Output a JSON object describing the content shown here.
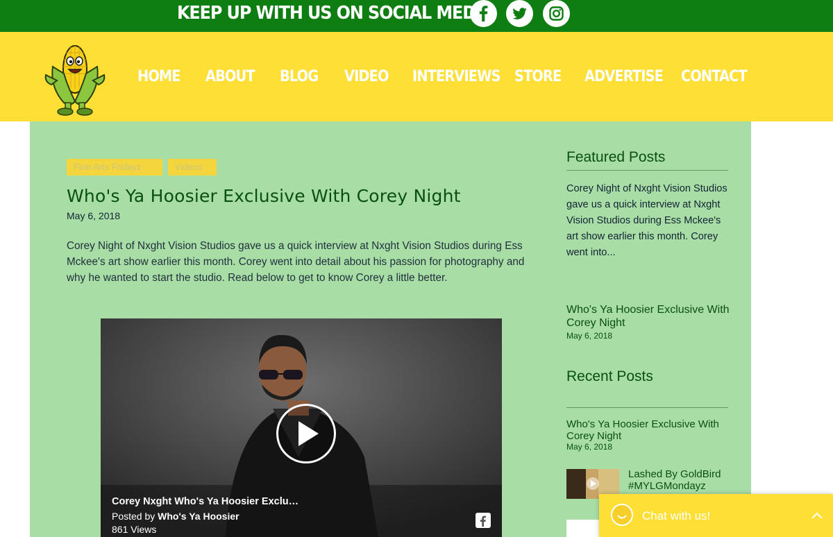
{
  "topbar": {
    "text": "KEEP UP WITH US ON SOCIAL MEDIA",
    "social": [
      "facebook-icon",
      "twitter-icon",
      "instagram-icon"
    ]
  },
  "nav": [
    "HOME",
    "ABOUT",
    "BLOG",
    "VIDEO",
    "INTERVIEWS",
    "STORE",
    "ADVERTISE",
    "CONTACT"
  ],
  "post": {
    "tags": [
      "Fine Arts Fridayz",
      "Videos"
    ],
    "title": "Who's Ya Hoosier Exclusive With Corey Night",
    "date": "May 6, 2018",
    "body": "Corey Night of Nxght Vision Studios gave us a quick interview at Nxght Vision Studios during Ess Mckee's art show earlier this month. Corey went into detail about his passion for photography and why he wanted to start the studio. Read below to get to know Corey a little better."
  },
  "video": {
    "title": "Corey Nxght Who's Ya Hoosier Exclu…",
    "posted_by_prefix": "Posted by ",
    "posted_by": "Who's Ya Hoosier",
    "views": "861 Views"
  },
  "sidebar": {
    "featured_heading": "Featured Posts",
    "featured_excerpt": "Corey Night of Nxght Vision Studios gave us a quick interview at Nxght Vision Studios during Ess Mckee's art show earlier this month. Corey went into...",
    "featured_title": "Who's Ya Hoosier Exclusive With Corey Night",
    "featured_date": "May 6, 2018",
    "recent_heading": "Recent Posts",
    "recent": [
      {
        "title": "Who's Ya Hoosier Exclusive With Corey Night",
        "date": "May 6, 2018"
      },
      {
        "title": "Lashed By GoldBird #MYLGMondayz"
      }
    ]
  },
  "chat": {
    "label": "Chat with us!"
  },
  "colors": {
    "green": "#0e7d12",
    "yellow": "#fddf35",
    "mint": "#a8dea6",
    "dark_green": "#0a4f12"
  }
}
